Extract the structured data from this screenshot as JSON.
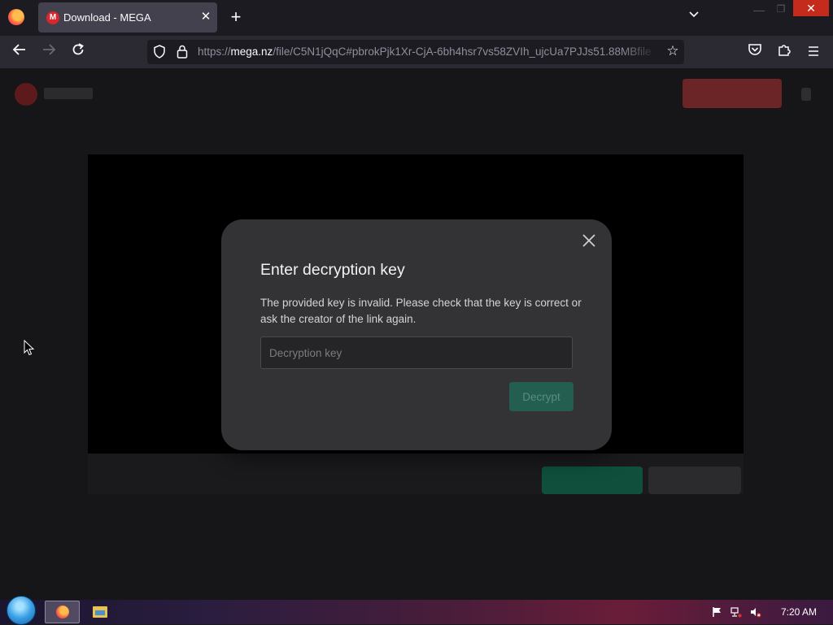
{
  "browser": {
    "tab": {
      "title": "Download - MEGA",
      "favicon_letter": "M"
    },
    "url": {
      "scheme": "https://",
      "host": "mega.nz",
      "path": "/file/C5N1jQqC#pbrokPjk1Xr-CjA-6bh4hsr7vs58ZVIh_ujcUa7PJJs51.88MBfile"
    }
  },
  "dialog": {
    "title": "Enter decryption key",
    "message": "The provided key is invalid. Please check that the key is correct or ask the creator of the link again.",
    "input_placeholder": "Decryption key",
    "input_value": "",
    "decrypt_label": "Decrypt"
  },
  "taskbar": {
    "clock": "7:20 AM"
  },
  "colors": {
    "dialog_bg": "#333335",
    "decrypt_button": "#235e51",
    "mega_red": "#d9272e"
  }
}
